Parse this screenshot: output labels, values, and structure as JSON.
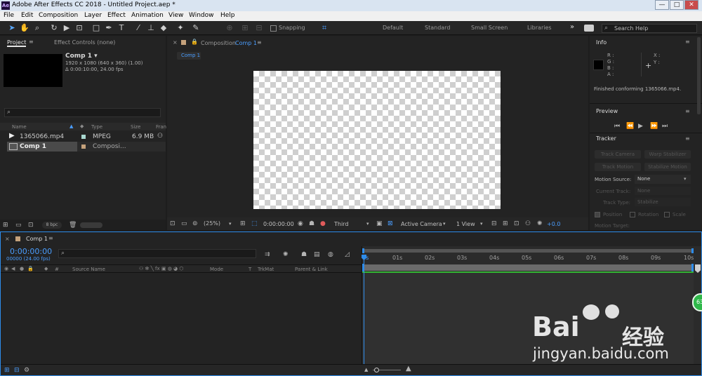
{
  "titlebar": {
    "app_icon": "Ae",
    "title": "Adobe After Effects CC 2018 - Untitled Project.aep *",
    "minimize": "—",
    "maximize": "□",
    "close": "✕"
  },
  "menu": [
    "File",
    "Edit",
    "Composition",
    "Layer",
    "Effect",
    "Animation",
    "View",
    "Window",
    "Help"
  ],
  "toolbar": {
    "snapping": "Snapping",
    "workspaces": [
      "Default",
      "Standard",
      "Small Screen",
      "Libraries"
    ],
    "more": "»",
    "search_placeholder": "Search Help"
  },
  "project": {
    "tab_project": "Project",
    "tab_effect_controls": "Effect Controls (none)",
    "comp_name": "Comp 1 ▾",
    "comp_res": "1920 x 1080  (640 x 360) (1.00)",
    "comp_dur": "Δ 0:00:10:00, 24.00 fps",
    "search_icon": "⌕",
    "columns": {
      "name": "Name",
      "type": "Type",
      "size": "Size",
      "frame": "Fran"
    },
    "items": [
      {
        "name": "1365066.mp4",
        "type": "MPEG",
        "size": "6.9 MB",
        "color": "#a9d8d0"
      },
      {
        "name": "Comp 1",
        "type": "Composi...",
        "size": "",
        "color": "#c5a27c"
      }
    ],
    "bpc": "8 bpc"
  },
  "comp_viewer": {
    "tab_label": "Composition",
    "tab_comp": "Comp 1",
    "subtab": "Comp 1",
    "zoom": "(25%)",
    "timecode": "0:00:00:00",
    "view": "Third",
    "camera": "Active Camera",
    "views": "1 View",
    "exposure": "+0.0"
  },
  "info": {
    "title": "Info",
    "r": "R :",
    "g": "G :",
    "b": "B :",
    "a": "A :",
    "x": "X :",
    "y": "Y :",
    "message": "Finished conforming 1365066.mp4."
  },
  "preview": {
    "title": "Preview"
  },
  "tracker": {
    "title": "Tracker",
    "track_camera": "Track Camera",
    "warp_stabilizer": "Warp Stabilizer",
    "track_motion": "Track Motion",
    "stabilize_motion": "Stabilize Motion",
    "motion_source_label": "Motion Source:",
    "motion_source_value": "None",
    "current_track_label": "Current Track:",
    "current_track_value": "None",
    "track_type_label": "Track Type:",
    "track_type_value": "Stabilize",
    "position": "Position",
    "rotation": "Rotation",
    "scale": "Scale",
    "motion_target": "Motion Target:"
  },
  "timeline": {
    "tab": "Comp 1",
    "timecode": "0:00:00:00",
    "frames": "00000 (24.00 fps)",
    "columns": {
      "source_name": "Source Name",
      "mode": "Mode",
      "t": "T",
      "trkmat": "TrkMat",
      "parent": "Parent & Link"
    },
    "ruler": [
      "0s",
      "01s",
      "02s",
      "03s",
      "04s",
      "05s",
      "06s",
      "07s",
      "08s",
      "09s",
      "10s"
    ]
  },
  "watermark": {
    "brand": "Bai",
    "brand2": "经验",
    "url": "jingyan.baidu.com"
  },
  "badge": "63",
  "colors": {
    "accent": "#2d8ceb",
    "timecode": "#4a9eff",
    "workarea": "#2a8cf0",
    "green": "#33b233"
  }
}
